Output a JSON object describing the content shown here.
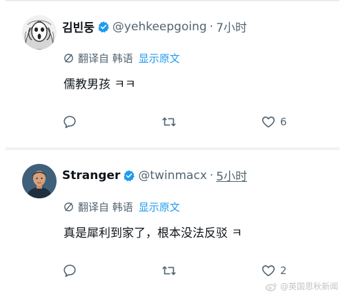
{
  "tweets": [
    {
      "display_name": "김빈둥",
      "handle": "@yehkeepgoing",
      "separator": "·",
      "time": "7小时",
      "translate": {
        "label": "翻译自 韩语",
        "show_original": "显示原文"
      },
      "text": "儒教男孩 ㅋㅋ",
      "actions": {
        "reply": "",
        "retweet": "",
        "like": "6"
      }
    },
    {
      "display_name": "Stranger",
      "handle": "@twinmacx",
      "separator": "·",
      "time": "5小时",
      "translate": {
        "label": "翻译自 韩语",
        "show_original": "显示原文"
      },
      "text": "真是犀利到家了，根本没法反驳 ㅋ",
      "actions": {
        "reply": "",
        "retweet": "",
        "like": "2"
      }
    }
  ],
  "watermark": "@英国恩秋新闻",
  "colors": {
    "accent": "#1d9bf0",
    "muted": "#536471",
    "text": "#0f1419"
  }
}
